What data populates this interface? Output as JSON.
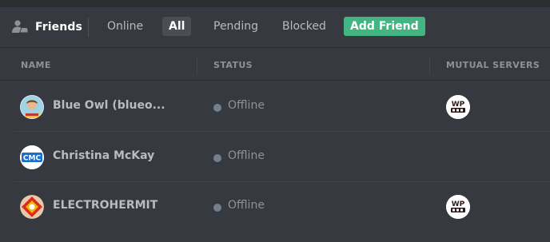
{
  "toolbar": {
    "title": "Friends",
    "tabs": {
      "online": "Online",
      "all": "All",
      "pending": "Pending",
      "blocked": "Blocked",
      "add_friend": "Add Friend"
    }
  },
  "table": {
    "headers": {
      "name": "NAME",
      "status": "STATUS",
      "mutual": "MUTUAL SERVERS"
    },
    "rows": [
      {
        "name": "Blue Owl (blueo...",
        "status": "Offline",
        "server_badge": "WP"
      },
      {
        "name": "Christina McKay",
        "avatar_text": "CMC",
        "status": "Offline"
      },
      {
        "name": "ELECTROHERMIT",
        "status": "Offline",
        "server_badge": "WP"
      }
    ]
  },
  "colors": {
    "background": "#36393f",
    "add_friend": "#43b581",
    "status_offline": "#747f8d",
    "cmc_blue": "#1b6fd1"
  }
}
